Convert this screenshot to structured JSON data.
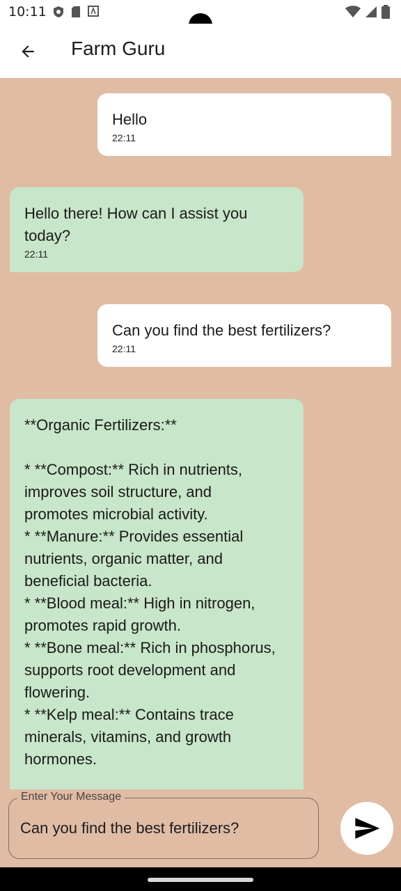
{
  "status": {
    "time": "10:11"
  },
  "app_bar": {
    "title": "Farm Guru"
  },
  "messages": [
    {
      "sender": "user",
      "text": "Hello",
      "time": "22:11"
    },
    {
      "sender": "bot",
      "text": "Hello there! How can I assist you\ntoday?",
      "time": "22:11"
    },
    {
      "sender": "user",
      "text": "Can you find the best fertilizers?",
      "time": "22:11"
    },
    {
      "sender": "bot",
      "text": "**Organic Fertilizers:**\n\n* **Compost:** Rich in nutrients,\nimproves soil structure, and\npromotes microbial activity.\n* **Manure:** Provides essential\nnutrients, organic matter, and\nbeneficial bacteria.\n* **Blood meal:** High in nitrogen,\npromotes rapid growth.\n* **Bone meal:** Rich in phosphorus,\nsupports root development and\nflowering.\n* **Kelp meal:** Contains trace\nminerals, vitamins, and growth\nhormones.",
      "time": ""
    }
  ],
  "input": {
    "label": "Enter Your Message",
    "value": "Can you find the best fertilizers?"
  },
  "colors": {
    "background": "#e0bca4",
    "user_bubble": "#ffffff",
    "bot_bubble": "#c8e6c9"
  },
  "icons": {
    "back": "arrow-back-icon",
    "send": "send-icon"
  }
}
